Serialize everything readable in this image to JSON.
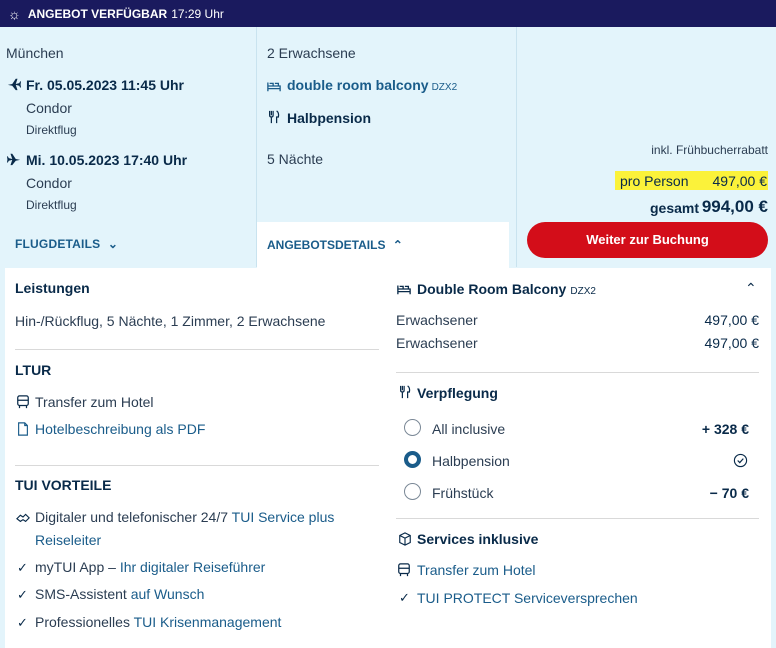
{
  "topbar": {
    "title": "ANGEBOT VERFÜGBAR",
    "time": "17:29 Uhr"
  },
  "flight": {
    "origin": "München",
    "outbound": {
      "date": "Fr. 05.05.2023 11:45 Uhr",
      "airline": "Condor",
      "type": "Direktflug"
    },
    "inbound": {
      "date": "Mi. 10.05.2023 17:40 Uhr",
      "airline": "Condor",
      "type": "Direktflug"
    },
    "details_label": "FLUGDETAILS"
  },
  "offer": {
    "travellers": "2 Erwachsene",
    "room": "double room balcony",
    "room_code": "DZX2",
    "board": "Halbpension",
    "nights": "5 Nächte",
    "details_label": "ANGEBOTSDETAILS"
  },
  "price": {
    "discount_note": "inkl. Frühbucherrabatt",
    "per_person_label": "pro Person",
    "per_person_value": "497,00 €",
    "total_label": "gesamt",
    "total_value": "994,00 €",
    "book_button": "Weiter zur Buchung",
    "highlight_color": "#fbf23a",
    "button_color": "#d30d19"
  },
  "leistungen": {
    "heading": "Leistungen",
    "summary": "Hin-/Rückflug, 5 Nächte, 1 Zimmer, 2 Erwachsene"
  },
  "ltur": {
    "heading": "LTUR",
    "transfer": "Transfer zum Hotel",
    "pdf": "Hotelbeschreibung als PDF"
  },
  "tui": {
    "heading": "TUI VORTEILE",
    "item1_a": "Digitaler und telefonischer 24/7 ",
    "item1_link": "TUI Service plus",
    "item1_b": "Reiseleiter",
    "item2_a": "myTUI App – ",
    "item2_link": "Ihr digitaler Reiseführer",
    "item3_a": "SMS-Assistent ",
    "item3_link": "auf Wunsch",
    "item4_a": "Professionelles ",
    "item4_link": "TUI Krisenmanagement"
  },
  "room_detail": {
    "title": "Double Room Balcony",
    "code": "DZX2",
    "rows": [
      {
        "label": "Erwachsener",
        "price": "497,00 €"
      },
      {
        "label": "Erwachsener",
        "price": "497,00 €"
      }
    ]
  },
  "verpflegung": {
    "heading": "Verpflegung",
    "options": [
      {
        "label": "All inclusive",
        "price": "+ 328 €"
      },
      {
        "label": "Halbpension",
        "price": ""
      },
      {
        "label": "Frühstück",
        "price": "− 70 €"
      }
    ]
  },
  "services": {
    "heading": "Services inklusive",
    "transfer": "Transfer zum Hotel",
    "protect_a": "TUI PROTECT ",
    "protect_link": "Serviceversprechen"
  }
}
